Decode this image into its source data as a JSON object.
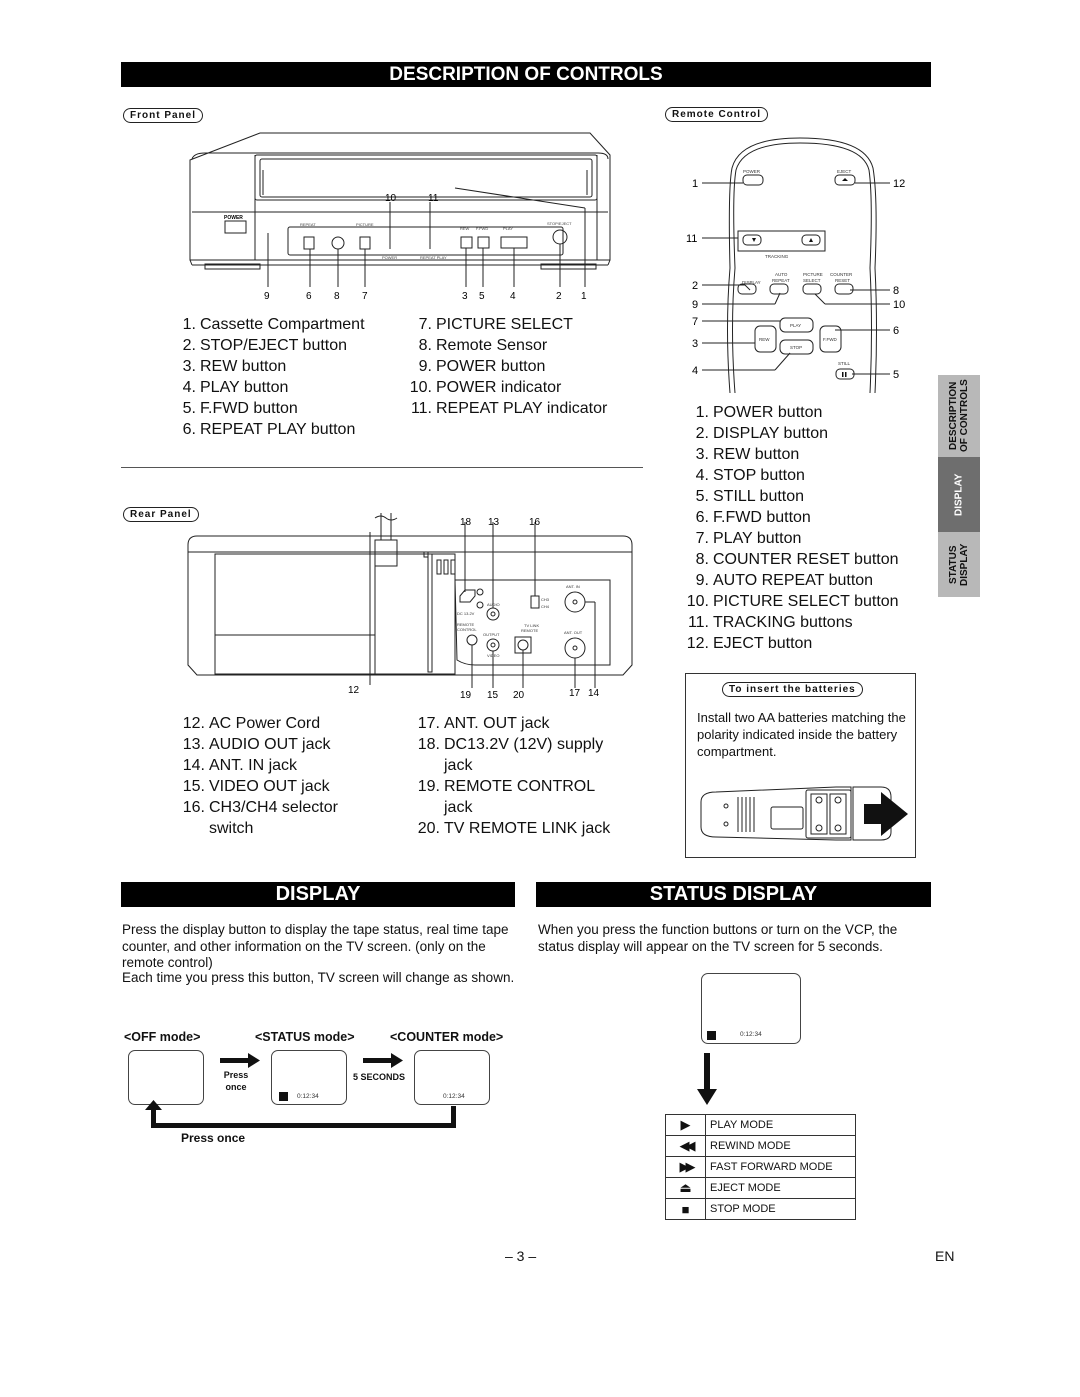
{
  "header": {
    "title": "DESCRIPTION OF CONTROLS"
  },
  "front_panel": {
    "label": "Front Panel",
    "diagram_labels": {
      "power": "POWER",
      "repeat_play": "REPEAT PLAY",
      "picture_select": "PICTURE SELECT",
      "rew": "REW",
      "ffwd": "F.FWD",
      "play": "PLAY",
      "stop_eject": "STOP/EJECT",
      "power_ind": "POWER",
      "repeat_play_ind": "REPEAT PLAY"
    },
    "callouts_top": [
      "10",
      "11"
    ],
    "callouts_bottom": [
      "9",
      "6",
      "8",
      "7",
      "3",
      "5",
      "4",
      "2",
      "1"
    ],
    "items_left": [
      {
        "num": "1.",
        "label": "Cassette Compartment"
      },
      {
        "num": "2.",
        "label": "STOP/EJECT button"
      },
      {
        "num": "3.",
        "label": "REW button"
      },
      {
        "num": "4.",
        "label": "PLAY button"
      },
      {
        "num": "5.",
        "label": "F.FWD button"
      },
      {
        "num": "6.",
        "label": "REPEAT PLAY button"
      }
    ],
    "items_right": [
      {
        "num": "7.",
        "label": "PICTURE SELECT"
      },
      {
        "num": "8.",
        "label": "Remote Sensor"
      },
      {
        "num": "9.",
        "label": "POWER button"
      },
      {
        "num": "10.",
        "label": "POWER indicator"
      },
      {
        "num": "11.",
        "label": "REPEAT PLAY indicator"
      }
    ]
  },
  "remote_control": {
    "label": "Remote Control",
    "diagram_labels": {
      "power": "POWER",
      "eject": "EJECT",
      "tracking": "TRACKING",
      "display": "DISPLAY",
      "auto": "AUTO",
      "repeat": "REPEAT",
      "picture": "PICTURE",
      "select": "SELECT",
      "counter": "COUNTER",
      "reset": "RESET",
      "play": "PLAY",
      "rew": "REW",
      "ffwd": "F.FWD",
      "stop": "STOP",
      "still": "STILL"
    },
    "callouts_left": [
      "1",
      "11",
      "2",
      "9",
      "7",
      "3",
      "4"
    ],
    "callouts_right": [
      "12",
      "8",
      "10",
      "6",
      "5"
    ],
    "items": [
      {
        "num": "1.",
        "label": "POWER button"
      },
      {
        "num": "2.",
        "label": "DISPLAY button"
      },
      {
        "num": "3.",
        "label": "REW button"
      },
      {
        "num": "4.",
        "label": "STOP button"
      },
      {
        "num": "5.",
        "label": "STILL button"
      },
      {
        "num": "6.",
        "label": "F.FWD button"
      },
      {
        "num": "7.",
        "label": "PLAY button"
      },
      {
        "num": "8.",
        "label": "COUNTER RESET button"
      },
      {
        "num": "9.",
        "label": "AUTO REPEAT button"
      },
      {
        "num": "10.",
        "label": "PICTURE SELECT button"
      },
      {
        "num": "11.",
        "label": "TRACKING buttons"
      },
      {
        "num": "12.",
        "label": "EJECT button"
      }
    ]
  },
  "side_tabs": [
    {
      "label": "DESCRIPTION OF CONTROLS",
      "active": false
    },
    {
      "label": "DISPLAY",
      "active": true
    },
    {
      "label": "STATUS DISPLAY",
      "active": false
    }
  ],
  "rear_panel": {
    "label": "Rear Panel",
    "diagram_labels": {
      "ch3": "CH3",
      "ch4": "CH4",
      "ant_in": "ANT. IN",
      "ant_out": "ANT. OUT",
      "audio": "AUDIO",
      "output": "OUTPUT",
      "video": "VIDEO",
      "remote_control": "REMOTE CONTROL",
      "tv_link": "TV  LINK",
      "remote": "REMOTE",
      "dc": "DC 13.2V"
    },
    "callouts_top": [
      "18",
      "13",
      "16"
    ],
    "callouts_bottom": [
      "12",
      "19",
      "15",
      "20",
      "17",
      "14"
    ],
    "items_left": [
      {
        "num": "12.",
        "label": "AC Power Cord"
      },
      {
        "num": "13.",
        "label": "AUDIO OUT jack"
      },
      {
        "num": "14.",
        "label": "ANT. IN jack"
      },
      {
        "num": "15.",
        "label": "VIDEO OUT jack"
      },
      {
        "num": "16.",
        "label": "CH3/CH4 selector"
      },
      {
        "num": "",
        "label": "switch"
      }
    ],
    "items_right": [
      {
        "num": "17.",
        "label": "ANT. OUT jack"
      },
      {
        "num": "18.",
        "label": "DC13.2V (12V) supply"
      },
      {
        "num": "",
        "label": "jack"
      },
      {
        "num": "19.",
        "label": "REMOTE CONTROL"
      },
      {
        "num": "",
        "label": "jack"
      },
      {
        "num": "20.",
        "label": "TV REMOTE LINK jack"
      }
    ]
  },
  "batteries": {
    "title": "To insert the batteries",
    "text": "Install two AA batteries matching the polarity indicated inside the battery compartment."
  },
  "display_section": {
    "title": "DISPLAY",
    "paragraph1": "Press the display button to display the tape status, real time tape counter, and other information on the TV screen. (only on the remote control)",
    "paragraph2": "Each time you press this button, TV screen will change as shown.",
    "modes": [
      "<OFF mode>",
      "<STATUS mode>",
      "<COUNTER mode>"
    ],
    "press_once_arrow": "Press once",
    "press_once_arrow2": "",
    "five_seconds": "5 SECONDS",
    "press_once_bottom": "Press once",
    "counter": "0:12:34"
  },
  "status_section": {
    "title": "STATUS DISPLAY",
    "paragraph": "When you press the function buttons or turn on the VCP, the status display will appear on the TV screen for 5 seconds.",
    "counter": "0:12:34",
    "modes": [
      {
        "icon": "play-icon",
        "glyph": "▶",
        "label": "PLAY MODE"
      },
      {
        "icon": "rewind-icon",
        "glyph": "◀◀",
        "label": "REWIND MODE"
      },
      {
        "icon": "fast-forward-icon",
        "glyph": "▶▶",
        "label": "FAST FORWARD MODE"
      },
      {
        "icon": "eject-icon",
        "glyph": "⏏",
        "label": "EJECT MODE"
      },
      {
        "icon": "stop-icon",
        "glyph": "■",
        "label": "STOP MODE"
      }
    ]
  },
  "footer": {
    "page_number": "– 3 –",
    "language": "EN"
  }
}
